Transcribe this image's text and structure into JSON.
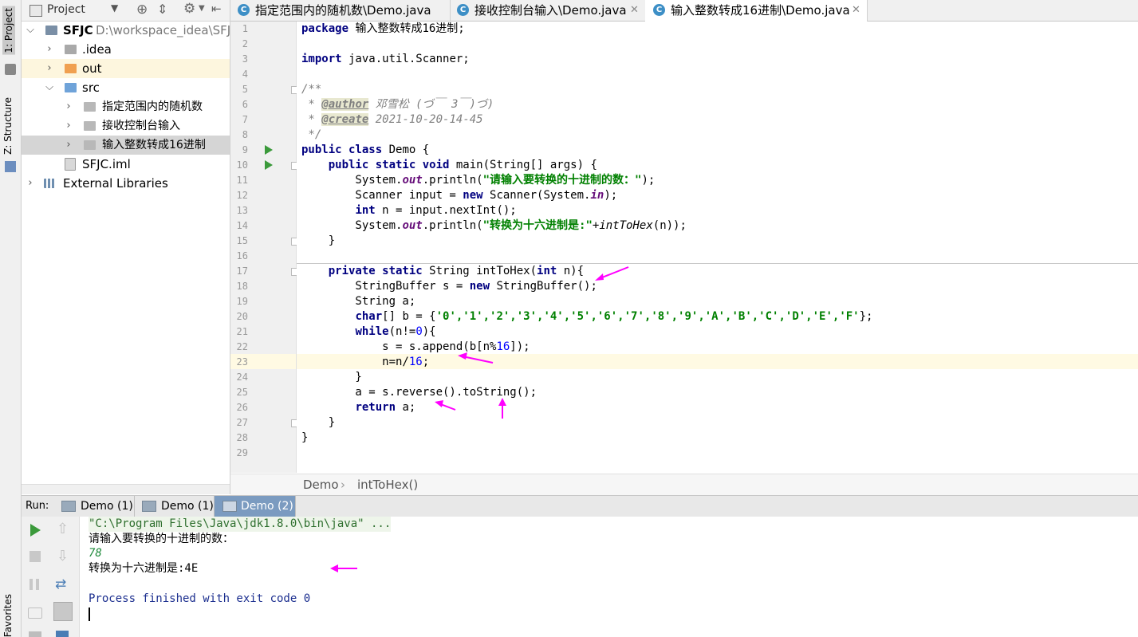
{
  "left_strip": {
    "project_tab": "1: Project",
    "structure_tab": "Z: Structure",
    "favorites_tab": "Favorites"
  },
  "project_panel": {
    "title": "Project",
    "tree": [
      {
        "label": "SFJC",
        "path": "D:\\workspace_idea\\SFJC",
        "kind": "module"
      },
      {
        "label": ".idea",
        "kind": "folder"
      },
      {
        "label": "out",
        "kind": "folder-orange"
      },
      {
        "label": "src",
        "kind": "folder-src"
      },
      {
        "label": "指定范围内的随机数",
        "kind": "package"
      },
      {
        "label": "接收控制台输入",
        "kind": "package"
      },
      {
        "label": "输入整数转成16进制",
        "kind": "package"
      },
      {
        "label": "SFJC.iml",
        "kind": "file"
      },
      {
        "label": "External Libraries",
        "kind": "library"
      }
    ]
  },
  "tabs": [
    {
      "label": "指定范围内的随机数\\Demo.java",
      "active": false
    },
    {
      "label": "接收控制台输入\\Demo.java",
      "active": false
    },
    {
      "label": "输入整数转成16进制\\Demo.java",
      "active": true
    }
  ],
  "code_lines": [
    "1",
    "2",
    "3",
    "4",
    "5",
    "6",
    "7",
    "8",
    "9",
    "10",
    "11",
    "12",
    "13",
    "14",
    "15",
    "16",
    "17",
    "18",
    "19",
    "20",
    "21",
    "22",
    "23",
    "24",
    "25",
    "26",
    "27",
    "28",
    "29"
  ],
  "code": {
    "l1_kw": "package",
    "l1_rest": " 输入整数转成16进制;",
    "l3_kw": "import",
    "l3_rest": " java.util.Scanner;",
    "l5": "/**",
    "l6_a": " * ",
    "l6_tag": "@author",
    "l6_b": " 邓雪松 (づ￣ 3￣)づ)",
    "l7_a": " * ",
    "l7_tag": "@create",
    "l7_b": " 2021-10-20-14-45",
    "l8": " */",
    "l9_kw": "public class",
    "l9_rest": " Demo {",
    "l10_ind": "    ",
    "l10_kw": "public static void",
    "l10_rest": " main(String[] args) {",
    "l11_a": "        System.",
    "l11_fld": "out",
    "l11_b": ".println(",
    "l11_str": "\"请输入要转换的十进制的数：\"",
    "l11_c": ");",
    "l12_a": "        Scanner input = ",
    "l12_kw": "new",
    "l12_b": " Scanner(System.",
    "l12_fld": "in",
    "l12_c": ");",
    "l13_ind": "        ",
    "l13_kw": "int",
    "l13_rest": " n = input.nextInt();",
    "l14_a": "        System.",
    "l14_fld": "out",
    "l14_b": ".println(",
    "l14_str": "\"转换为十六进制是:\"",
    "l14_c": "+",
    "l14_stat": "intToHex",
    "l14_d": "(n));",
    "l15": "    }",
    "l17_ind": "    ",
    "l17_kw": "private static",
    "l17_mid": " String intToHex(",
    "l17_kw2": "int",
    "l17_rest": " n){",
    "l18_a": "        StringBuffer s = ",
    "l18_kw": "new",
    "l18_b": " StringBuffer();",
    "l19": "        String a;",
    "l20_ind": "        ",
    "l20_kw": "char",
    "l20_a": "[] b = {",
    "l20_chars": "'0','1','2','3','4','5','6','7','8','9','A','B','C','D','E','F'",
    "l20_b": "};",
    "l21_ind": "        ",
    "l21_kw": "while",
    "l21_a": "(n!=",
    "l21_num": "0",
    "l21_b": "){",
    "l22_a": "            s = s.append(b[n%",
    "l22_num": "16",
    "l22_b": "]);",
    "l23_a": "            n=n/",
    "l23_num": "16",
    "l23_b": ";",
    "l24": "        }",
    "l25": "        a = s.reverse().toString();",
    "l26_ind": "        ",
    "l26_kw": "return",
    "l26_rest": " a;",
    "l27": "    }",
    "l28": "}"
  },
  "breadcrumb": {
    "class_name": "Demo",
    "method_name": "intToHex()"
  },
  "run": {
    "label": "Run:",
    "tabs": [
      {
        "label": "Demo (1)",
        "active": false
      },
      {
        "label": "Demo (1)",
        "active": false
      },
      {
        "label": "Demo (2)",
        "active": true
      }
    ],
    "console": {
      "cmd": "\"C:\\Program Files\\Java\\jdk1.8.0\\bin\\java\" ...",
      "prompt": "请输入要转换的十进制的数：",
      "input": "78",
      "result": "转换为十六进制是:4E",
      "exit": "Process finished with exit code 0"
    }
  },
  "colors": {
    "keyword": "#000080",
    "string": "#008000",
    "number": "#0000ff",
    "comment": "#808080",
    "annotation_arrow": "#ff00ff",
    "current_line": "#fffae3"
  }
}
